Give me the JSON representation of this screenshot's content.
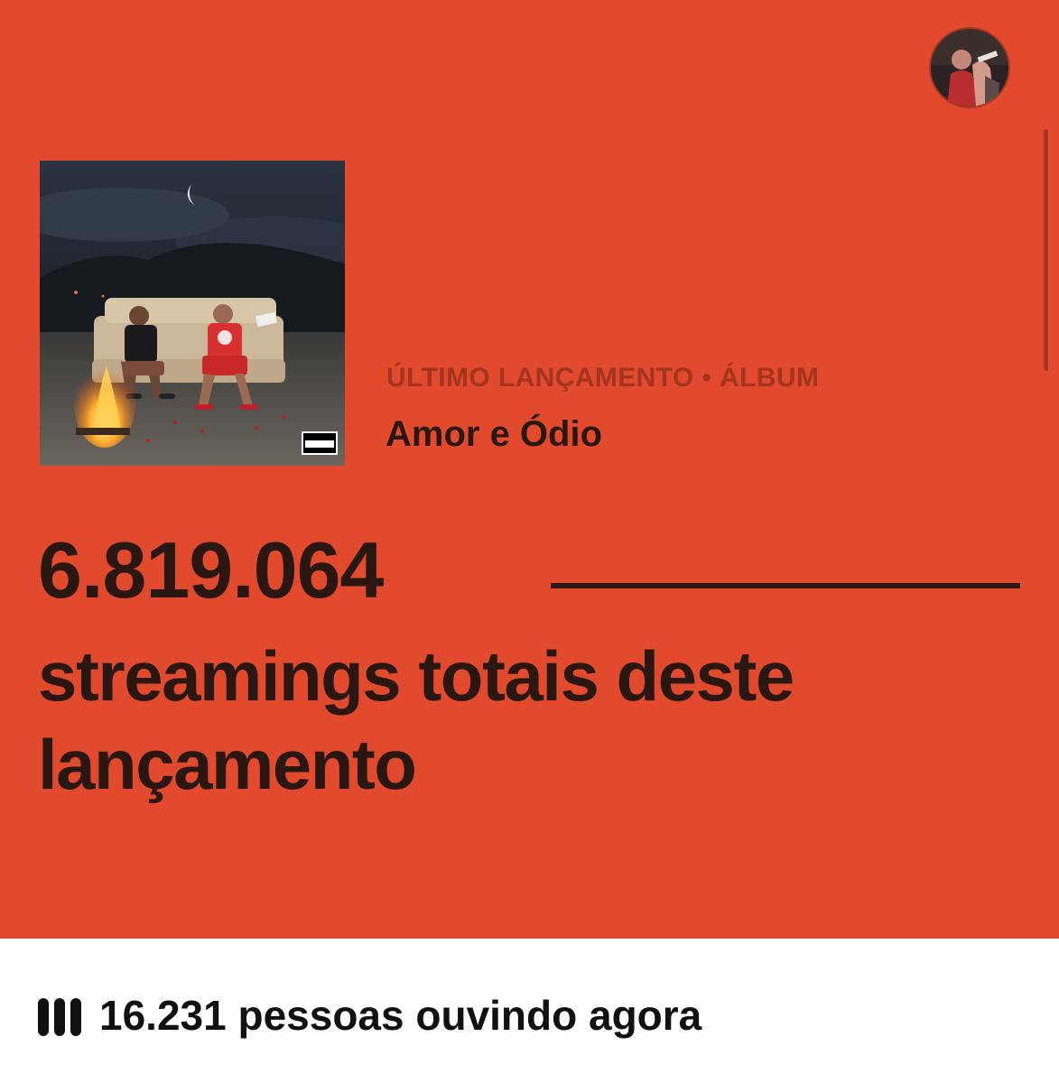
{
  "release": {
    "label": "ÚLTIMO LANÇAMENTO • ÁLBUM",
    "title": "Amor e Ódio",
    "cover_badge": "PARENTAL ADVISORY EXPLICIT CONTENT"
  },
  "streams": {
    "count": "6.819.064",
    "line1": "streamings totais deste",
    "line2": "lançamento"
  },
  "live": {
    "text": "16.231 pessoas ouvindo agora"
  },
  "icons": {
    "listeners": "equalizer-bars-icon",
    "profile": "artist-avatar"
  },
  "colors": {
    "background": "#e24a2e",
    "label": "#a3341d",
    "text": "#2a1712",
    "footer_bg": "#ffffff"
  }
}
